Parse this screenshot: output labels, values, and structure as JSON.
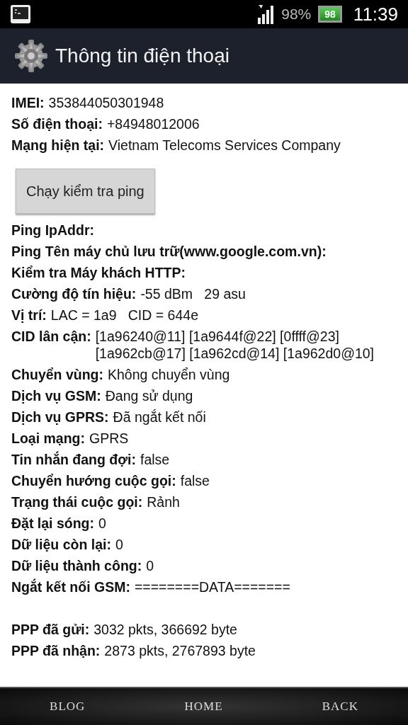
{
  "status_bar": {
    "battery_percent": "98%",
    "battery_icon_text": "98",
    "time": "11:39"
  },
  "action_bar": {
    "title": "Thông tin điện thoại"
  },
  "info_top": [
    {
      "label": "IMEI:",
      "value": "353844050301948"
    },
    {
      "label": "Số điện thoại:",
      "value": "+84948012006"
    },
    {
      "label": "Mạng hiện tại:",
      "value": "Vietnam Telecoms Services Company"
    }
  ],
  "ping_button": "Chạy kiểm tra ping",
  "info_main": [
    {
      "label": "Ping IpAddr:"
    },
    {
      "label": "Ping Tên máy chủ lưu trữ(www.google.com.vn):"
    },
    {
      "label": "Kiểm tra Máy khách HTTP:"
    },
    {
      "label": "Cường độ tín hiệu:",
      "value": "-55 dBm   29 asu"
    },
    {
      "label": "Vị trí:",
      "value": "LAC = 1a9   CID = 644e"
    },
    {
      "label": "CID lân cận:",
      "value": "[1a96240@11] [1a9644f@22] [0ffff@23] [1a962cb@17] [1a962cd@14] [1a962d0@10]"
    },
    {
      "label": "Chuyển vùng:",
      "value": "Không chuyển vùng"
    },
    {
      "label": "Dịch vụ GSM:",
      "value": "Đang sử dụng"
    },
    {
      "label": "Dịch vụ GPRS:",
      "value": "Đã ngắt kết nối"
    },
    {
      "label": "Loại mạng:",
      "value": "GPRS"
    },
    {
      "label": "Tin nhắn đang đợi:",
      "value": "false"
    },
    {
      "label": "Chuyển hướng cuộc gọi:",
      "value": "false"
    },
    {
      "label": "Trạng thái cuộc gọi:",
      "value": "Rảnh"
    },
    {
      "label": "Đặt lại sóng:",
      "value": "0"
    },
    {
      "label": "Dữ liệu còn lại:",
      "value": "0"
    },
    {
      "label": "Dữ liệu thành công:",
      "value": "0"
    },
    {
      "label": "Ngắt kết nối GSM:",
      "value": "========DATA======="
    }
  ],
  "info_ppp": [
    {
      "label": "PPP đã gửi:",
      "value": "3032 pkts, 366692 byte"
    },
    {
      "label": "PPP đã nhận:",
      "value": "2873 pkts, 2767893 byte"
    }
  ],
  "nav_bar": [
    "BLOG",
    "HOME",
    "BACK"
  ]
}
